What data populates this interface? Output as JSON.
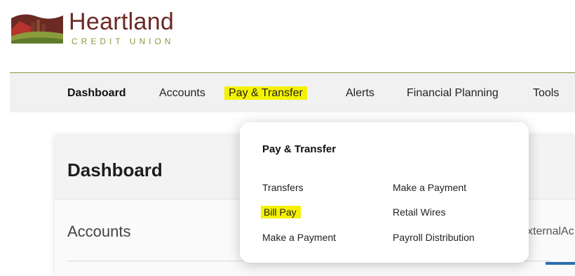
{
  "brand": {
    "name": "Heartland",
    "subtitle": "CREDIT UNION",
    "colors": {
      "maroon": "#6b2a24",
      "olive": "#8a9b3c",
      "highlight": "#f5f200"
    }
  },
  "nav": {
    "items": [
      {
        "label": "Dashboard",
        "active": true
      },
      {
        "label": "Accounts"
      },
      {
        "label": "Pay & Transfer",
        "highlighted": true
      },
      {
        "label": "Alerts"
      },
      {
        "label": "Financial Planning"
      },
      {
        "label": "Tools"
      }
    ]
  },
  "dropdown": {
    "title": "Pay & Transfer",
    "left_col": [
      "Transfers",
      "Bill Pay",
      "Make a Payment"
    ],
    "right_col": [
      "Make a Payment",
      "Retail Wires",
      "Payroll Distribution"
    ]
  },
  "main": {
    "title": "Dashboard",
    "accounts_label": "Accounts",
    "external_text": "xternalAc"
  }
}
